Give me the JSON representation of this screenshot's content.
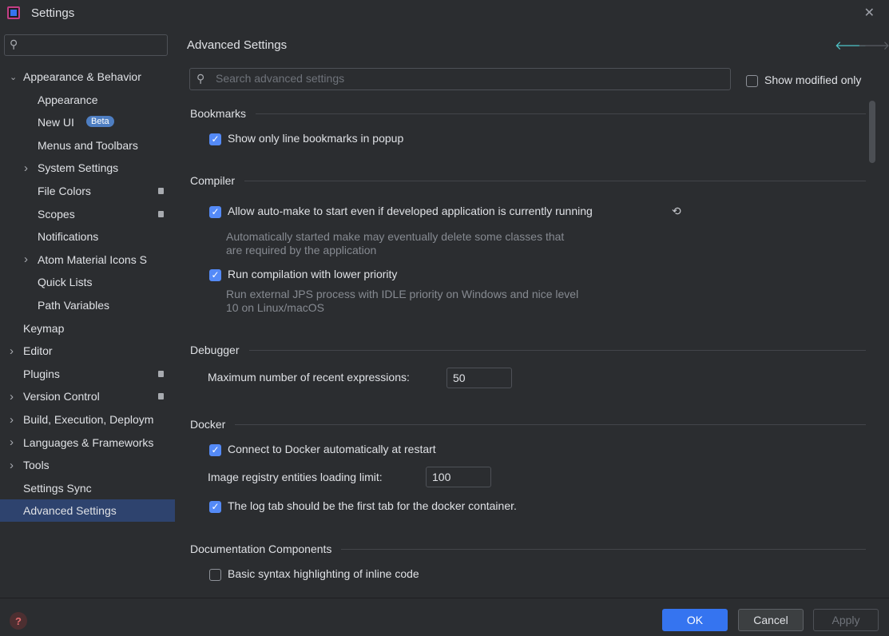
{
  "window": {
    "title": "Settings"
  },
  "sidebar": {
    "search_placeholder": "",
    "items": [
      {
        "label": "Appearance & Behavior",
        "level": 0,
        "arrow": "expanded"
      },
      {
        "label": "Appearance",
        "level": 1
      },
      {
        "label": "New UI",
        "level": 1,
        "badge": "Beta"
      },
      {
        "label": "Menus and Toolbars",
        "level": 1
      },
      {
        "label": "System Settings",
        "level": 1,
        "arrow": "collapsed"
      },
      {
        "label": "File Colors",
        "level": 1,
        "marker": true
      },
      {
        "label": "Scopes",
        "level": 1,
        "marker": true
      },
      {
        "label": "Notifications",
        "level": 1
      },
      {
        "label": "Atom Material Icons S",
        "level": 1,
        "arrow": "collapsed"
      },
      {
        "label": "Quick Lists",
        "level": 1
      },
      {
        "label": "Path Variables",
        "level": 1
      },
      {
        "label": "Keymap",
        "level": 0
      },
      {
        "label": "Editor",
        "level": 0,
        "arrow": "collapsed"
      },
      {
        "label": "Plugins",
        "level": 0,
        "marker": true
      },
      {
        "label": "Version Control",
        "level": 0,
        "arrow": "collapsed",
        "marker": true
      },
      {
        "label": "Build, Execution, Deploym",
        "level": 0,
        "arrow": "collapsed"
      },
      {
        "label": "Languages & Frameworks",
        "level": 0,
        "arrow": "collapsed"
      },
      {
        "label": "Tools",
        "level": 0,
        "arrow": "collapsed"
      },
      {
        "label": "Settings Sync",
        "level": 0
      },
      {
        "label": "Advanced Settings",
        "level": 0,
        "selected": true
      }
    ]
  },
  "main": {
    "title": "Advanced Settings",
    "search_placeholder": "Search advanced settings",
    "show_modified_only": {
      "label": "Show modified only",
      "checked": false
    },
    "sections": {
      "bookmarks": {
        "title": "Bookmarks",
        "show_line_bookmarks": {
          "label": "Show only line bookmarks in popup",
          "checked": true
        }
      },
      "compiler": {
        "title": "Compiler",
        "auto_make": {
          "label": "Allow auto-make to start even if developed application is currently running",
          "checked": true,
          "desc_line1": "Automatically started make may eventually delete some classes that",
          "desc_line2": "are required by the application"
        },
        "lower_priority": {
          "label": "Run compilation with lower priority",
          "checked": true,
          "desc_line1": "Run external JPS process with IDLE priority on Windows and nice level",
          "desc_line2": "10 on Linux/macOS"
        }
      },
      "debugger": {
        "title": "Debugger",
        "max_recent_label": "Maximum number of recent expressions:",
        "max_recent_value": "50"
      },
      "docker": {
        "title": "Docker",
        "connect_auto": {
          "label": "Connect to Docker automatically at restart",
          "checked": true
        },
        "registry_limit_label": "Image registry entities loading limit:",
        "registry_limit_value": "100",
        "log_tab_first": {
          "label": "The log tab should be the first tab for the docker container.",
          "checked": true
        }
      },
      "documentation": {
        "title": "Documentation Components",
        "basic_syntax": {
          "label": "Basic syntax highlighting of inline code",
          "checked": false
        }
      }
    }
  },
  "footer": {
    "ok": "OK",
    "cancel": "Cancel",
    "apply": "Apply",
    "help_glyph": "?"
  },
  "colors": {
    "background": "#2b2d30",
    "selection": "#2e436e",
    "accent": "#3574f0",
    "checkbox": "#548af7",
    "back_arrow": "#4fc3c7"
  }
}
